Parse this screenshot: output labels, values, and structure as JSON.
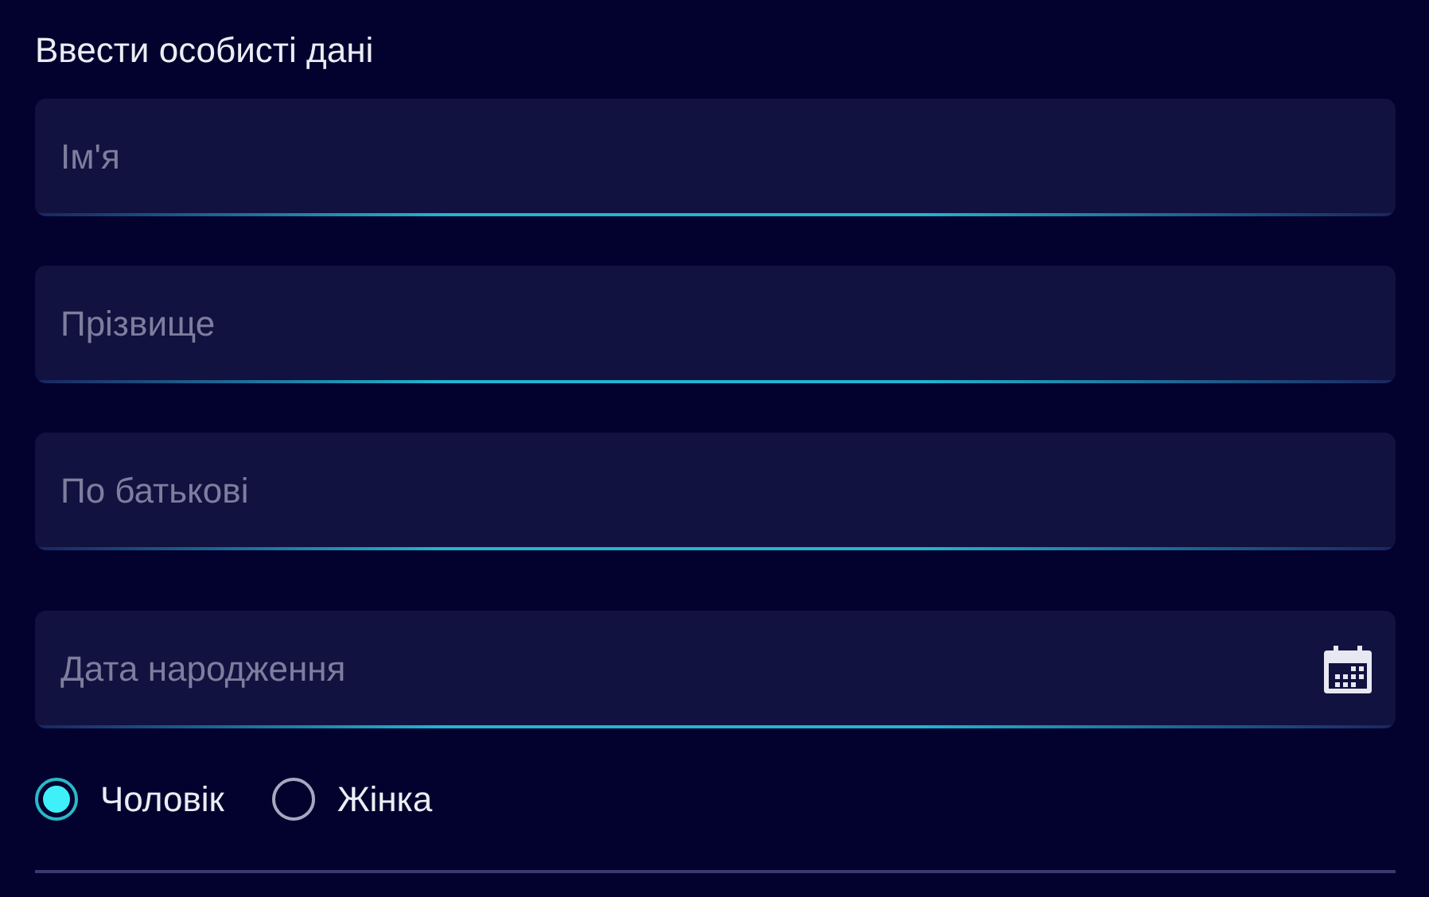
{
  "section_title": "Ввести особисті дані",
  "fields": [
    {
      "kind": "text",
      "placeholder": "Ім'я"
    },
    {
      "kind": "text",
      "placeholder": "Прізвище"
    },
    {
      "kind": "text",
      "placeholder": "По батькові"
    },
    {
      "kind": "date",
      "placeholder": "Дата народження"
    }
  ],
  "gender": [
    {
      "label": "Чоловік",
      "selected": true
    },
    {
      "label": "Жінка",
      "selected": false
    }
  ]
}
